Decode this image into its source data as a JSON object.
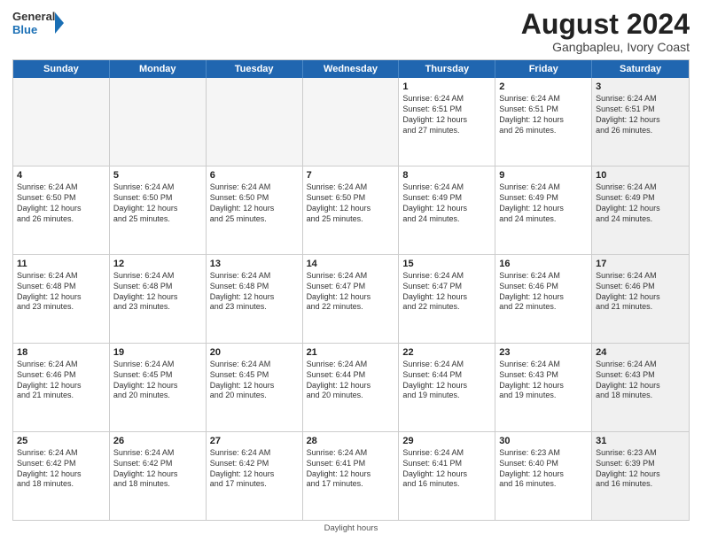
{
  "logo": {
    "general": "General",
    "blue": "Blue"
  },
  "title": "August 2024",
  "location": "Gangbapleu, Ivory Coast",
  "days": [
    "Sunday",
    "Monday",
    "Tuesday",
    "Wednesday",
    "Thursday",
    "Friday",
    "Saturday"
  ],
  "footer": "Daylight hours",
  "weeks": [
    [
      {
        "day": "",
        "content": "",
        "empty": true
      },
      {
        "day": "",
        "content": "",
        "empty": true
      },
      {
        "day": "",
        "content": "",
        "empty": true
      },
      {
        "day": "",
        "content": "",
        "empty": true
      },
      {
        "day": "1",
        "content": "Sunrise: 6:24 AM\nSunset: 6:51 PM\nDaylight: 12 hours\nand 27 minutes.",
        "empty": false
      },
      {
        "day": "2",
        "content": "Sunrise: 6:24 AM\nSunset: 6:51 PM\nDaylight: 12 hours\nand 26 minutes.",
        "empty": false
      },
      {
        "day": "3",
        "content": "Sunrise: 6:24 AM\nSunset: 6:51 PM\nDaylight: 12 hours\nand 26 minutes.",
        "empty": false,
        "shaded": true
      }
    ],
    [
      {
        "day": "4",
        "content": "Sunrise: 6:24 AM\nSunset: 6:50 PM\nDaylight: 12 hours\nand 26 minutes.",
        "empty": false
      },
      {
        "day": "5",
        "content": "Sunrise: 6:24 AM\nSunset: 6:50 PM\nDaylight: 12 hours\nand 25 minutes.",
        "empty": false
      },
      {
        "day": "6",
        "content": "Sunrise: 6:24 AM\nSunset: 6:50 PM\nDaylight: 12 hours\nand 25 minutes.",
        "empty": false
      },
      {
        "day": "7",
        "content": "Sunrise: 6:24 AM\nSunset: 6:50 PM\nDaylight: 12 hours\nand 25 minutes.",
        "empty": false
      },
      {
        "day": "8",
        "content": "Sunrise: 6:24 AM\nSunset: 6:49 PM\nDaylight: 12 hours\nand 24 minutes.",
        "empty": false
      },
      {
        "day": "9",
        "content": "Sunrise: 6:24 AM\nSunset: 6:49 PM\nDaylight: 12 hours\nand 24 minutes.",
        "empty": false
      },
      {
        "day": "10",
        "content": "Sunrise: 6:24 AM\nSunset: 6:49 PM\nDaylight: 12 hours\nand 24 minutes.",
        "empty": false,
        "shaded": true
      }
    ],
    [
      {
        "day": "11",
        "content": "Sunrise: 6:24 AM\nSunset: 6:48 PM\nDaylight: 12 hours\nand 23 minutes.",
        "empty": false
      },
      {
        "day": "12",
        "content": "Sunrise: 6:24 AM\nSunset: 6:48 PM\nDaylight: 12 hours\nand 23 minutes.",
        "empty": false
      },
      {
        "day": "13",
        "content": "Sunrise: 6:24 AM\nSunset: 6:48 PM\nDaylight: 12 hours\nand 23 minutes.",
        "empty": false
      },
      {
        "day": "14",
        "content": "Sunrise: 6:24 AM\nSunset: 6:47 PM\nDaylight: 12 hours\nand 22 minutes.",
        "empty": false
      },
      {
        "day": "15",
        "content": "Sunrise: 6:24 AM\nSunset: 6:47 PM\nDaylight: 12 hours\nand 22 minutes.",
        "empty": false
      },
      {
        "day": "16",
        "content": "Sunrise: 6:24 AM\nSunset: 6:46 PM\nDaylight: 12 hours\nand 22 minutes.",
        "empty": false
      },
      {
        "day": "17",
        "content": "Sunrise: 6:24 AM\nSunset: 6:46 PM\nDaylight: 12 hours\nand 21 minutes.",
        "empty": false,
        "shaded": true
      }
    ],
    [
      {
        "day": "18",
        "content": "Sunrise: 6:24 AM\nSunset: 6:46 PM\nDaylight: 12 hours\nand 21 minutes.",
        "empty": false
      },
      {
        "day": "19",
        "content": "Sunrise: 6:24 AM\nSunset: 6:45 PM\nDaylight: 12 hours\nand 20 minutes.",
        "empty": false
      },
      {
        "day": "20",
        "content": "Sunrise: 6:24 AM\nSunset: 6:45 PM\nDaylight: 12 hours\nand 20 minutes.",
        "empty": false
      },
      {
        "day": "21",
        "content": "Sunrise: 6:24 AM\nSunset: 6:44 PM\nDaylight: 12 hours\nand 20 minutes.",
        "empty": false
      },
      {
        "day": "22",
        "content": "Sunrise: 6:24 AM\nSunset: 6:44 PM\nDaylight: 12 hours\nand 19 minutes.",
        "empty": false
      },
      {
        "day": "23",
        "content": "Sunrise: 6:24 AM\nSunset: 6:43 PM\nDaylight: 12 hours\nand 19 minutes.",
        "empty": false
      },
      {
        "day": "24",
        "content": "Sunrise: 6:24 AM\nSunset: 6:43 PM\nDaylight: 12 hours\nand 18 minutes.",
        "empty": false,
        "shaded": true
      }
    ],
    [
      {
        "day": "25",
        "content": "Sunrise: 6:24 AM\nSunset: 6:42 PM\nDaylight: 12 hours\nand 18 minutes.",
        "empty": false
      },
      {
        "day": "26",
        "content": "Sunrise: 6:24 AM\nSunset: 6:42 PM\nDaylight: 12 hours\nand 18 minutes.",
        "empty": false
      },
      {
        "day": "27",
        "content": "Sunrise: 6:24 AM\nSunset: 6:42 PM\nDaylight: 12 hours\nand 17 minutes.",
        "empty": false
      },
      {
        "day": "28",
        "content": "Sunrise: 6:24 AM\nSunset: 6:41 PM\nDaylight: 12 hours\nand 17 minutes.",
        "empty": false
      },
      {
        "day": "29",
        "content": "Sunrise: 6:24 AM\nSunset: 6:41 PM\nDaylight: 12 hours\nand 16 minutes.",
        "empty": false
      },
      {
        "day": "30",
        "content": "Sunrise: 6:23 AM\nSunset: 6:40 PM\nDaylight: 12 hours\nand 16 minutes.",
        "empty": false
      },
      {
        "day": "31",
        "content": "Sunrise: 6:23 AM\nSunset: 6:39 PM\nDaylight: 12 hours\nand 16 minutes.",
        "empty": false,
        "shaded": true
      }
    ]
  ]
}
